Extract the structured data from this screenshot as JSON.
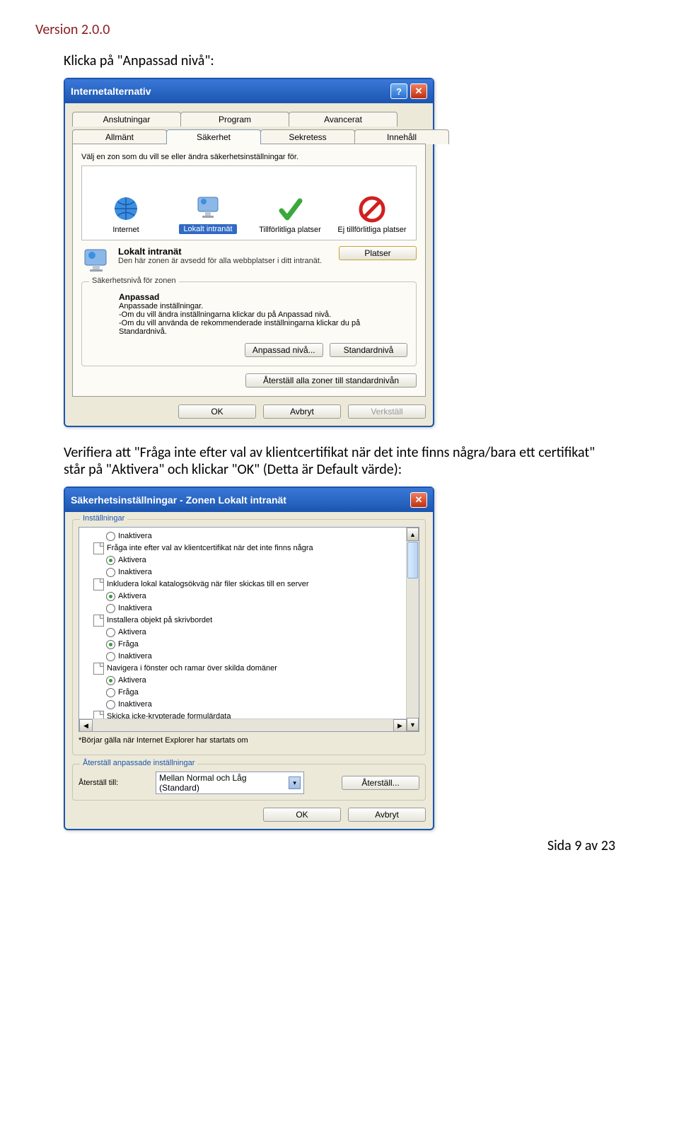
{
  "document": {
    "version": "Version 2.0.0",
    "instruction1": "Klicka på \"Anpassad nivå\":",
    "instruction2": "Verifiera att \"Fråga inte efter val av klientcertifikat när det inte finns några/bara ett certifikat\" står på  \"Aktivera\" och klickar \"OK\" (Detta är Default värde):",
    "page_footer": "Sida 9 av 23"
  },
  "options_dialog": {
    "title": "Internetalternativ",
    "tabs_back": [
      "Anslutningar",
      "Program",
      "Avancerat"
    ],
    "tabs_front": [
      "Allmänt",
      "Säkerhet",
      "Sekretess",
      "Innehåll"
    ],
    "zone_prompt": "Välj en zon som du vill se eller ändra säkerhetsinställningar för.",
    "zones": [
      {
        "label": "Internet"
      },
      {
        "label": "Lokalt intranät",
        "selected": true
      },
      {
        "label": "Tillförlitliga platser",
        "sub": ""
      },
      {
        "label": "Ej tillförlitliga platser",
        "sub": ""
      }
    ],
    "zone_name": "Lokalt intranät",
    "zone_desc": "Den här zonen är avsedd för alla webbplatser i ditt intranät.",
    "btn_places": "Platser",
    "group_security": "Säkerhetsnivå för zonen",
    "level_title": "Anpassad",
    "level_line1": "Anpassade inställningar.",
    "level_line2": "-Om du vill ändra inställningarna klickar du på Anpassad nivå.",
    "level_line3": "-Om du vill använda de rekommenderade inställningarna klickar du på Standardnivå.",
    "btn_custom": "Anpassad nivå...",
    "btn_standard": "Standardnivå",
    "btn_reset_all": "Återställ alla zoner till standardnivån",
    "btn_ok": "OK",
    "btn_cancel": "Avbryt",
    "btn_apply": "Verkställ"
  },
  "security_dialog": {
    "title": "Säkerhetsinställningar - Zonen Lokalt intranät",
    "group_settings": "Inställningar",
    "items": [
      {
        "type": "radio",
        "label": "Inaktivera",
        "selected": false
      },
      {
        "type": "node",
        "label": "Fråga inte efter val av klientcertifikat när det inte finns några"
      },
      {
        "type": "radio",
        "label": "Aktivera",
        "selected": true
      },
      {
        "type": "radio",
        "label": "Inaktivera",
        "selected": false
      },
      {
        "type": "node",
        "label": "Inkludera lokal katalogsökväg när filer skickas till en server"
      },
      {
        "type": "radio",
        "label": "Aktivera",
        "selected": true
      },
      {
        "type": "radio",
        "label": "Inaktivera",
        "selected": false
      },
      {
        "type": "node",
        "label": "Installera objekt på skrivbordet"
      },
      {
        "type": "radio",
        "label": "Aktivera",
        "selected": false
      },
      {
        "type": "radio",
        "label": "Fråga",
        "selected": true
      },
      {
        "type": "radio",
        "label": "Inaktivera",
        "selected": false
      },
      {
        "type": "node",
        "label": "Navigera i fönster och ramar över skilda domäner"
      },
      {
        "type": "radio",
        "label": "Aktivera",
        "selected": true
      },
      {
        "type": "radio",
        "label": "Fråga",
        "selected": false
      },
      {
        "type": "radio",
        "label": "Inaktivera",
        "selected": false
      },
      {
        "type": "node",
        "label": "Skicka icke-krypterade formulärdata"
      }
    ],
    "restart_note": "*Börjar gälla när Internet Explorer har startats om",
    "group_reset": "Återställ anpassade inställningar",
    "reset_label": "Återställ till:",
    "reset_value": "Mellan Normal och Låg (Standard)",
    "btn_reset": "Återställ...",
    "btn_ok": "OK",
    "btn_cancel": "Avbryt"
  }
}
